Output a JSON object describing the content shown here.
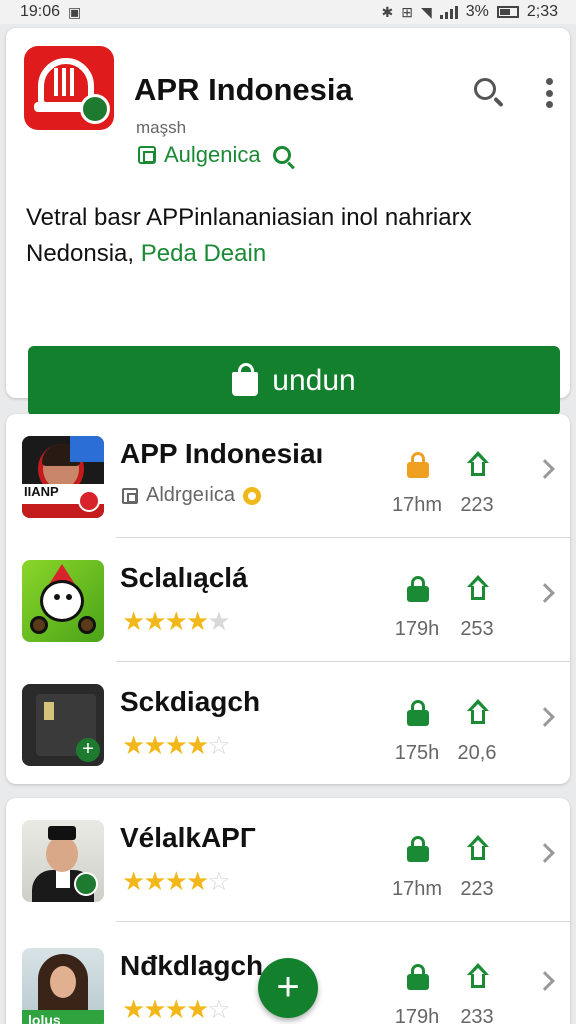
{
  "status_bar": {
    "time_left": "19:06",
    "battery": "3%",
    "time_right": "2;33"
  },
  "app": {
    "title": "APR Indonesia",
    "subtitle": "maşsh",
    "developer": "Aulgenica",
    "description_main": "Vetral basr APPinlananiasian inol nahriarx Nedonsia,",
    "description_link": "Peda Deain",
    "install_label": "undun"
  },
  "list": [
    {
      "title": "APP Indonesiaı",
      "subtitle": "Aldrgeıica",
      "rating": null,
      "size": "17hm",
      "count": "223",
      "lock_color": "#f0a020",
      "icon": "news-app-icon"
    },
    {
      "title": "Sclalıąclá",
      "subtitle": "",
      "rating": 4,
      "size": "179h",
      "count": "253",
      "lock_color": "#1b8a35",
      "icon": "cartoon-app-icon"
    },
    {
      "title": "Sckdiagch",
      "subtitle": "",
      "rating": 4,
      "size": "175h",
      "count": "20,6",
      "lock_color": "#1b8a35",
      "icon": "phone-app-icon"
    },
    {
      "title": "VélalkAPГ",
      "subtitle": "",
      "rating": 4,
      "size": "17hm",
      "count": "223",
      "lock_color": "#1b8a35",
      "icon": "man-app-icon"
    },
    {
      "title": "Nđkdlagch",
      "subtitle": "",
      "rating": 3.5,
      "size": "179h",
      "count": "233",
      "lock_color": "#1b8a35",
      "icon": "woman-app-icon",
      "icon_banner": "lolus"
    }
  ],
  "icons": {
    "search": "search-icon",
    "more": "more-vert-icon",
    "install": "shopping-bag-icon",
    "fab": "plus-icon",
    "icon_news_text": "IIANP"
  },
  "colors": {
    "accent": "#13802e",
    "link": "#1b8a35",
    "star": "#f2b81b",
    "app_icon_red": "#e01b1b"
  }
}
